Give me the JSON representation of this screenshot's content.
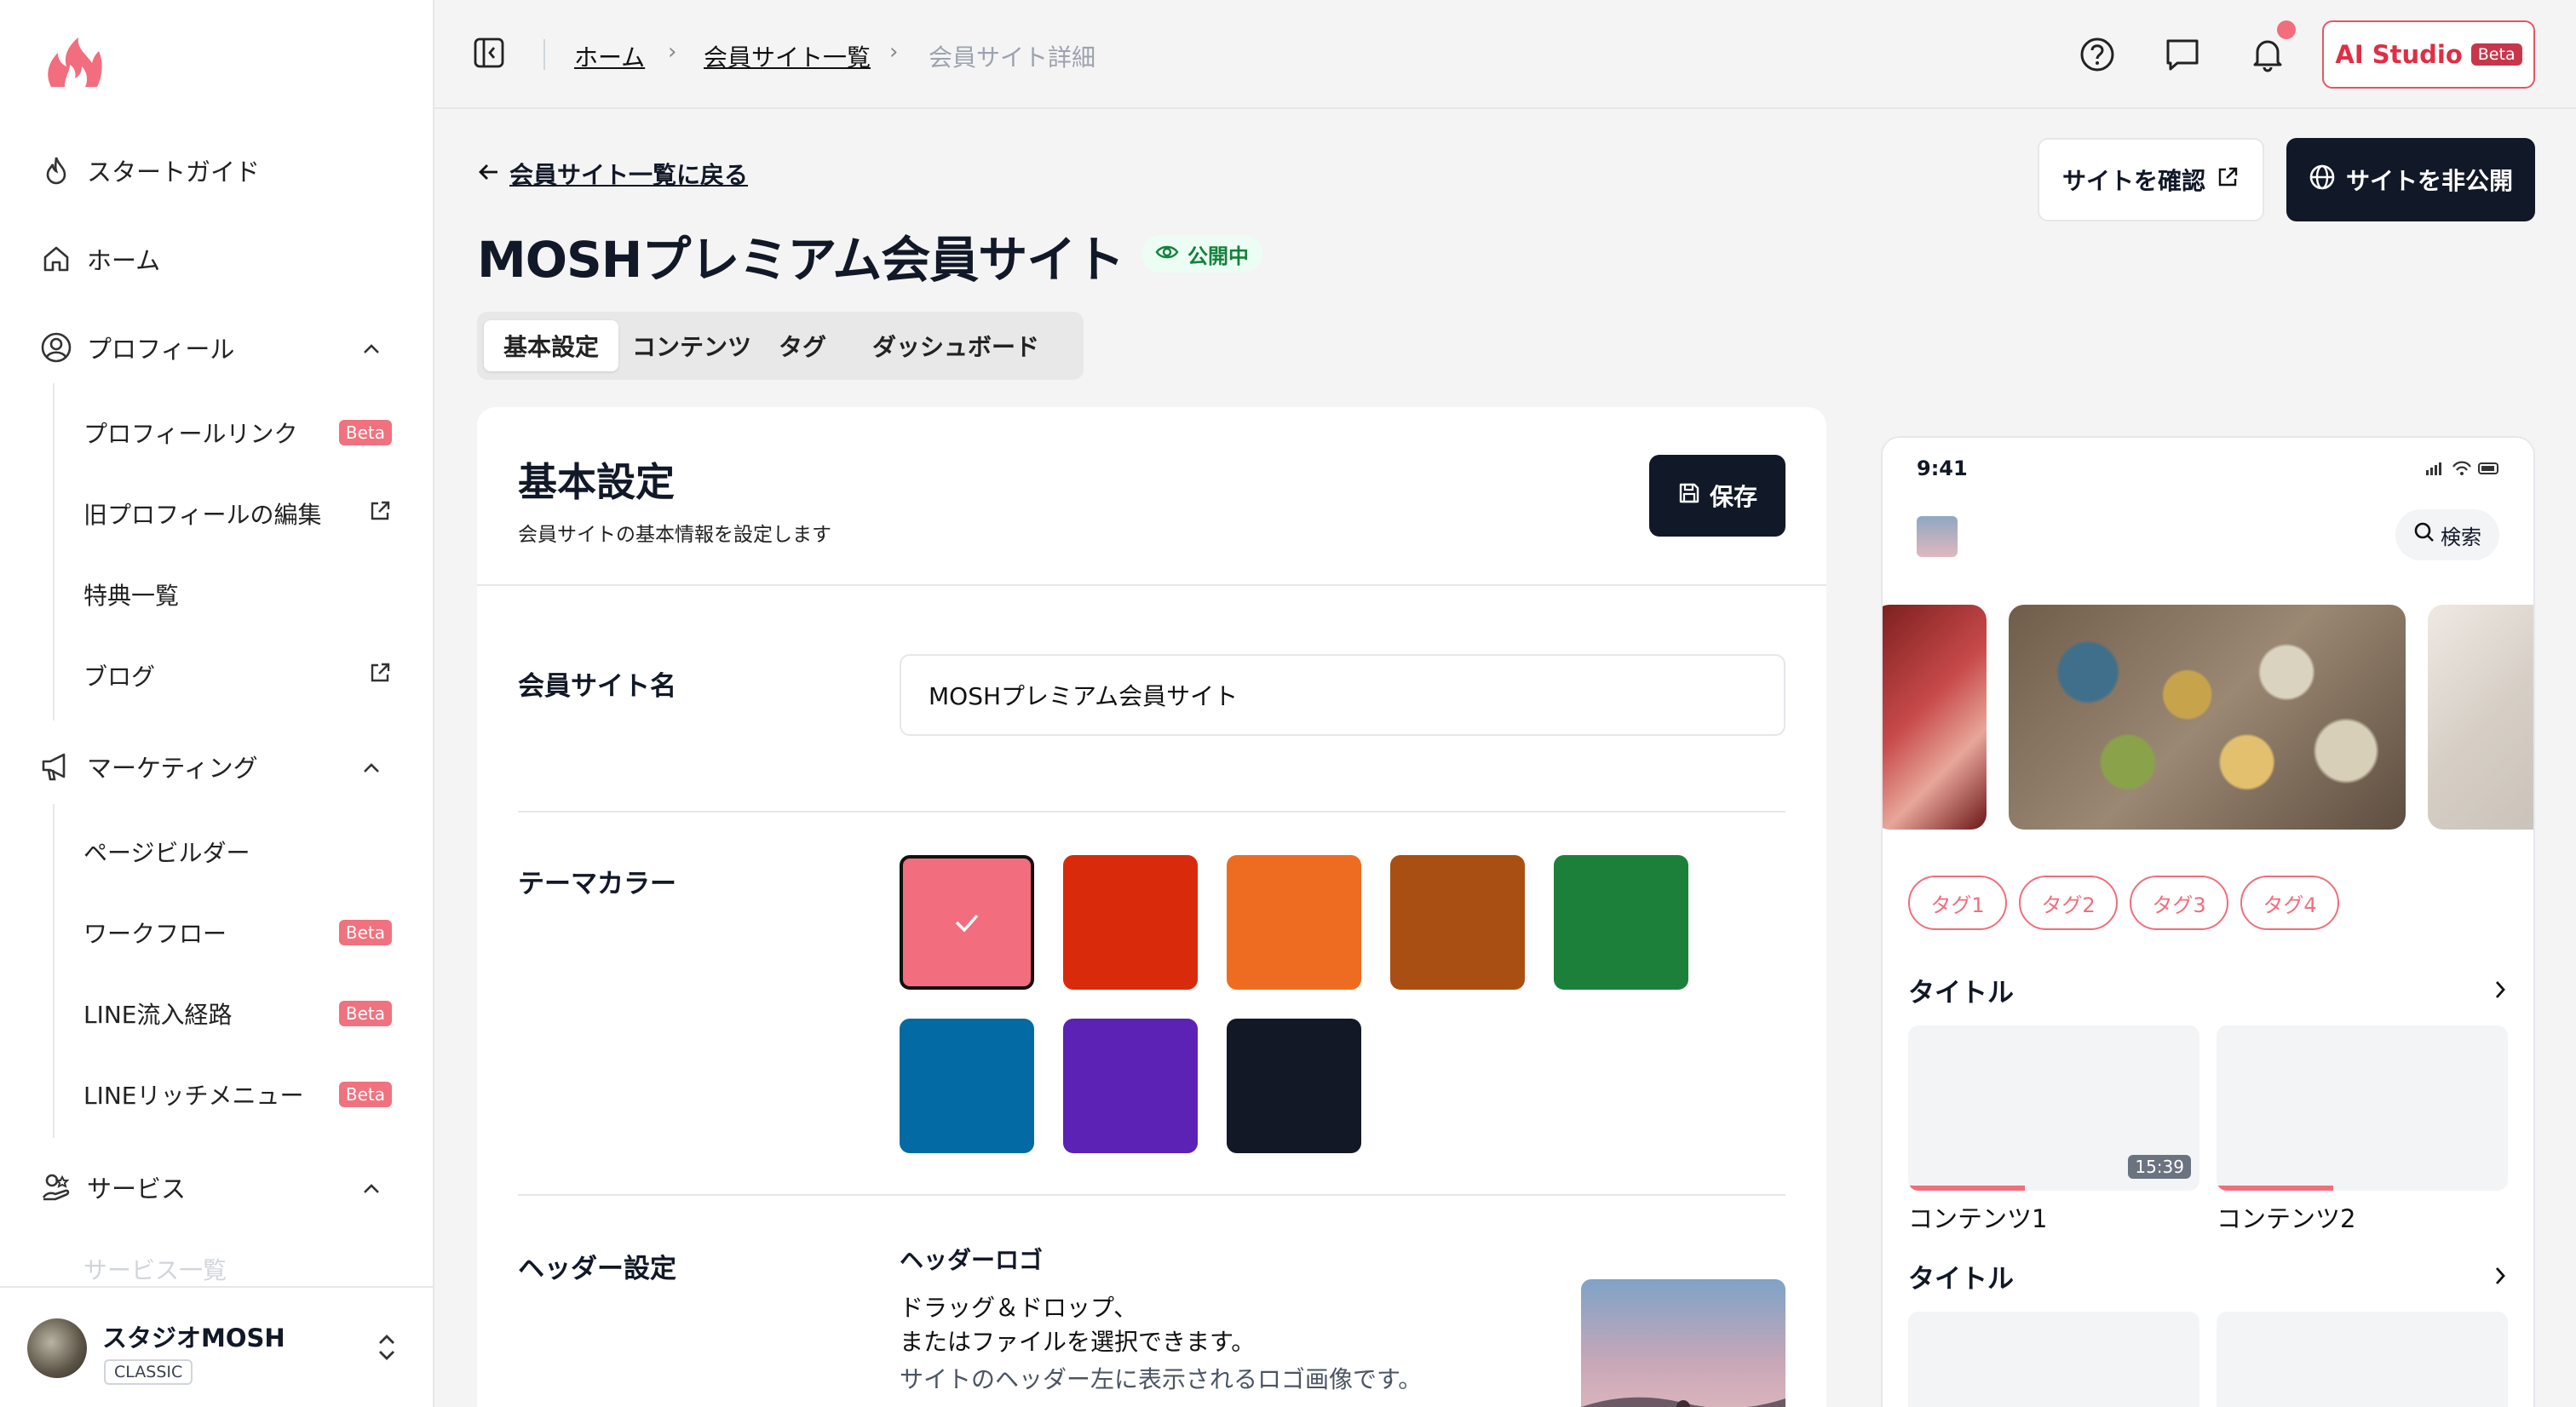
{
  "sidebar": {
    "nav": [
      {
        "label": "スタートガイド",
        "icon": "flame-icon"
      },
      {
        "label": "ホーム",
        "icon": "home-icon"
      },
      {
        "label": "プロフィール",
        "icon": "user-circle-icon"
      },
      {
        "label": "マーケティング",
        "icon": "megaphone-icon"
      },
      {
        "label": "サービス",
        "icon": "service-icon"
      }
    ],
    "profile_sub": [
      {
        "label": "プロフィールリンク",
        "badge": "Beta"
      },
      {
        "label": "旧プロフィールの編集",
        "icon": "external-link-icon"
      },
      {
        "label": "特典一覧"
      },
      {
        "label": "ブログ",
        "icon": "external-link-icon"
      }
    ],
    "marketing_sub": [
      {
        "label": "ページビルダー"
      },
      {
        "label": "ワークフロー",
        "badge": "Beta"
      },
      {
        "label": "LINE流入経路",
        "badge": "Beta"
      },
      {
        "label": "LINEリッチメニュー",
        "badge": "Beta"
      }
    ],
    "service_sub_partial": "サービス一覧",
    "account": {
      "name": "スタジオMOSH",
      "plan": "CLASSIC"
    }
  },
  "header": {
    "breadcrumb": [
      "ホーム",
      "会員サイト一覧",
      "会員サイト詳細"
    ],
    "ai_studio": {
      "label": "AI Studio",
      "badge": "Beta"
    }
  },
  "page": {
    "back_link": "会員サイト一覧に戻る",
    "title": "MOSHプレミアム会員サイト",
    "status": "公開中",
    "view_site_button": "サイトを確認",
    "unpublish_button": "サイトを非公開",
    "tabs": [
      "基本設定",
      "コンテンツ",
      "タグ",
      "ダッシュボード"
    ],
    "active_tab": "基本設定"
  },
  "settings": {
    "title": "基本設定",
    "subtitle": "会員サイトの基本情報を設定します",
    "save_button": "保存",
    "site_name_label": "会員サイト名",
    "site_name_value": "MOSHプレミアム会員サイト",
    "theme_color_label": "テーマカラー",
    "theme_colors": [
      "#f26d7d",
      "#d92a0c",
      "#ee6c22",
      "#a94f13",
      "#1c803b",
      "#046aa3",
      "#5c21b5",
      "#121826"
    ],
    "selected_theme_color": "#f26d7d",
    "header_label": "ヘッダー設定",
    "header_logo_title": "ヘッダーロゴ",
    "header_logo_drop_line1": "ドラッグ＆ドロップ、",
    "header_logo_drop_line2": "またはファイルを選択できます。",
    "header_logo_hint": "サイトのヘッダー左に表示されるロゴ画像です。"
  },
  "preview": {
    "time": "9:41",
    "search": "検索",
    "tags": [
      "タグ1",
      "タグ2",
      "タグ3",
      "タグ4"
    ],
    "section_title": "タイトル",
    "contents": [
      {
        "label": "コンテンツ1",
        "duration": "15:39",
        "progress": 0.4
      },
      {
        "label": "コンテンツ2",
        "progress": 0.4
      }
    ]
  }
}
